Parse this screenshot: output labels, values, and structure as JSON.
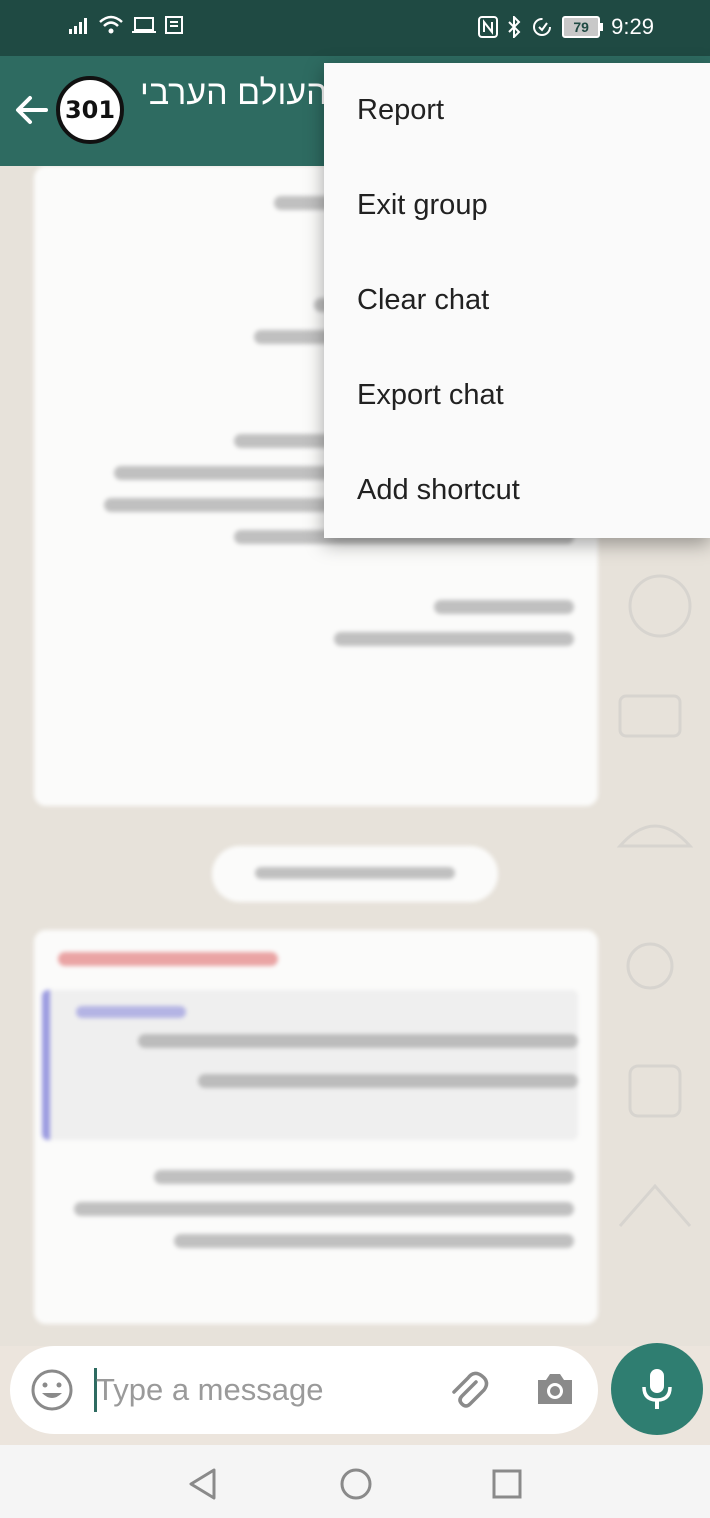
{
  "status_bar": {
    "time": "9:29",
    "battery": "79"
  },
  "header": {
    "group_name": "העולם הערבי",
    "avatar_text": "301"
  },
  "overflow_menu": {
    "items": [
      {
        "label": "Report"
      },
      {
        "label": "Exit group"
      },
      {
        "label": "Clear chat"
      },
      {
        "label": "Export chat"
      },
      {
        "label": "Add shortcut"
      }
    ]
  },
  "composer": {
    "placeholder": "Type a message"
  },
  "icons": {
    "back": "back-arrow-icon",
    "emoji": "emoji-icon",
    "attach": "paperclip-icon",
    "camera": "camera-icon",
    "mic": "mic-icon",
    "nav_back": "triangle-back-icon",
    "nav_home": "circle-home-icon",
    "nav_recents": "square-recents-icon"
  },
  "colors": {
    "status_bar": "#1f4a43",
    "app_bar": "#2e6b61",
    "mic_button": "#2f7e71",
    "menu_bg": "#fafafa"
  }
}
